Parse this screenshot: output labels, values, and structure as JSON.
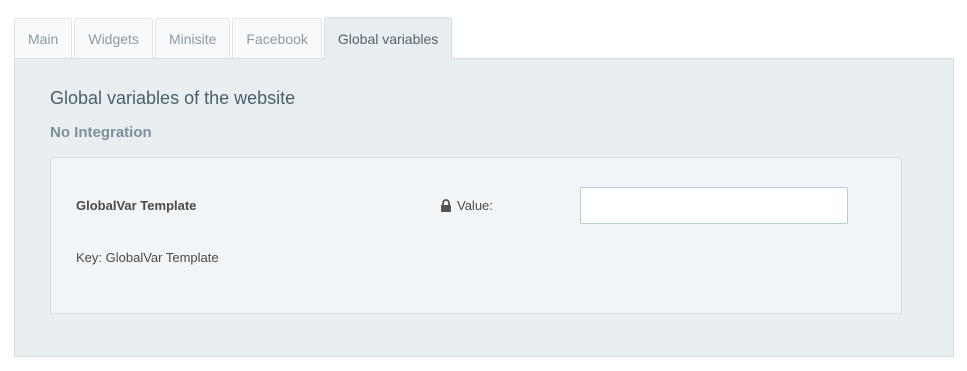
{
  "tabs": [
    {
      "label": "Main",
      "active": false
    },
    {
      "label": "Widgets",
      "active": false
    },
    {
      "label": "Minisite",
      "active": false
    },
    {
      "label": "Facebook",
      "active": false
    },
    {
      "label": "Global variables",
      "active": true
    }
  ],
  "panel": {
    "title": "Global variables of the website",
    "subtitle": "No Integration"
  },
  "variable": {
    "name": "GlobalVar Template",
    "key_text": "Key: GlobalVar Template",
    "value_label": "Value:",
    "value_icon": "lock-icon",
    "value": ""
  },
  "colors": {
    "panel_bg": "#e9eef1",
    "card_bg": "#f2f5f7",
    "input_border": "#b9cdd6",
    "title_text": "#4d5e6b"
  }
}
